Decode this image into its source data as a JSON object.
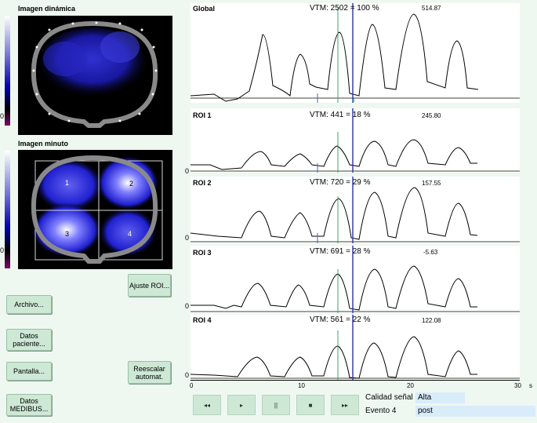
{
  "left": {
    "dynamic_title": "Imagen dinámica",
    "minute_title": "Imagen minuto",
    "scale_zero": "0",
    "roi_labels": [
      "1",
      "2",
      "3",
      "4"
    ]
  },
  "buttons": {
    "ajuste_roi": "Ajuste ROI...",
    "archivo": "Archivo...",
    "datos_paciente": "Datos paciente...",
    "pantalla": "Pantalla...",
    "reescalar": "Reescalar automat.",
    "datos_medibus": "Datos MEDIBUS..."
  },
  "traces": [
    {
      "title": "Global",
      "vtm": "VTM: 2502 = 100 %",
      "value": "514.87",
      "zero": "",
      "marker": "4"
    },
    {
      "title": "ROI 1",
      "vtm": "VTM: 441 = 18 %",
      "value": "245.80",
      "zero": "0"
    },
    {
      "title": "ROI 2",
      "vtm": "VTM: 720 = 29 %",
      "value": "157.55",
      "zero": "0"
    },
    {
      "title": "ROI 3",
      "vtm": "VTM: 691 = 28 %",
      "value": "-5.63",
      "zero": "0"
    },
    {
      "title": "ROI 4",
      "vtm": "VTM: 561 = 22 %",
      "value": "122.08",
      "zero": "0"
    }
  ],
  "axis": {
    "ticks": [
      "0",
      "10",
      "20",
      "30"
    ],
    "unit": "s"
  },
  "playback": {
    "rewind": "◂◂",
    "play": "▸",
    "pause": "||",
    "stop": "■",
    "forward": "▸▸"
  },
  "status": {
    "quality_label": "Calidad señal",
    "quality_value": "Alta",
    "event_label": "Evento 4",
    "event_value": "post"
  },
  "colors": {
    "accent": "#3a3fa0",
    "marker_green": "#3aa56a",
    "button_bg": "#cde8d4",
    "field_bg": "#d8ecfa"
  }
}
